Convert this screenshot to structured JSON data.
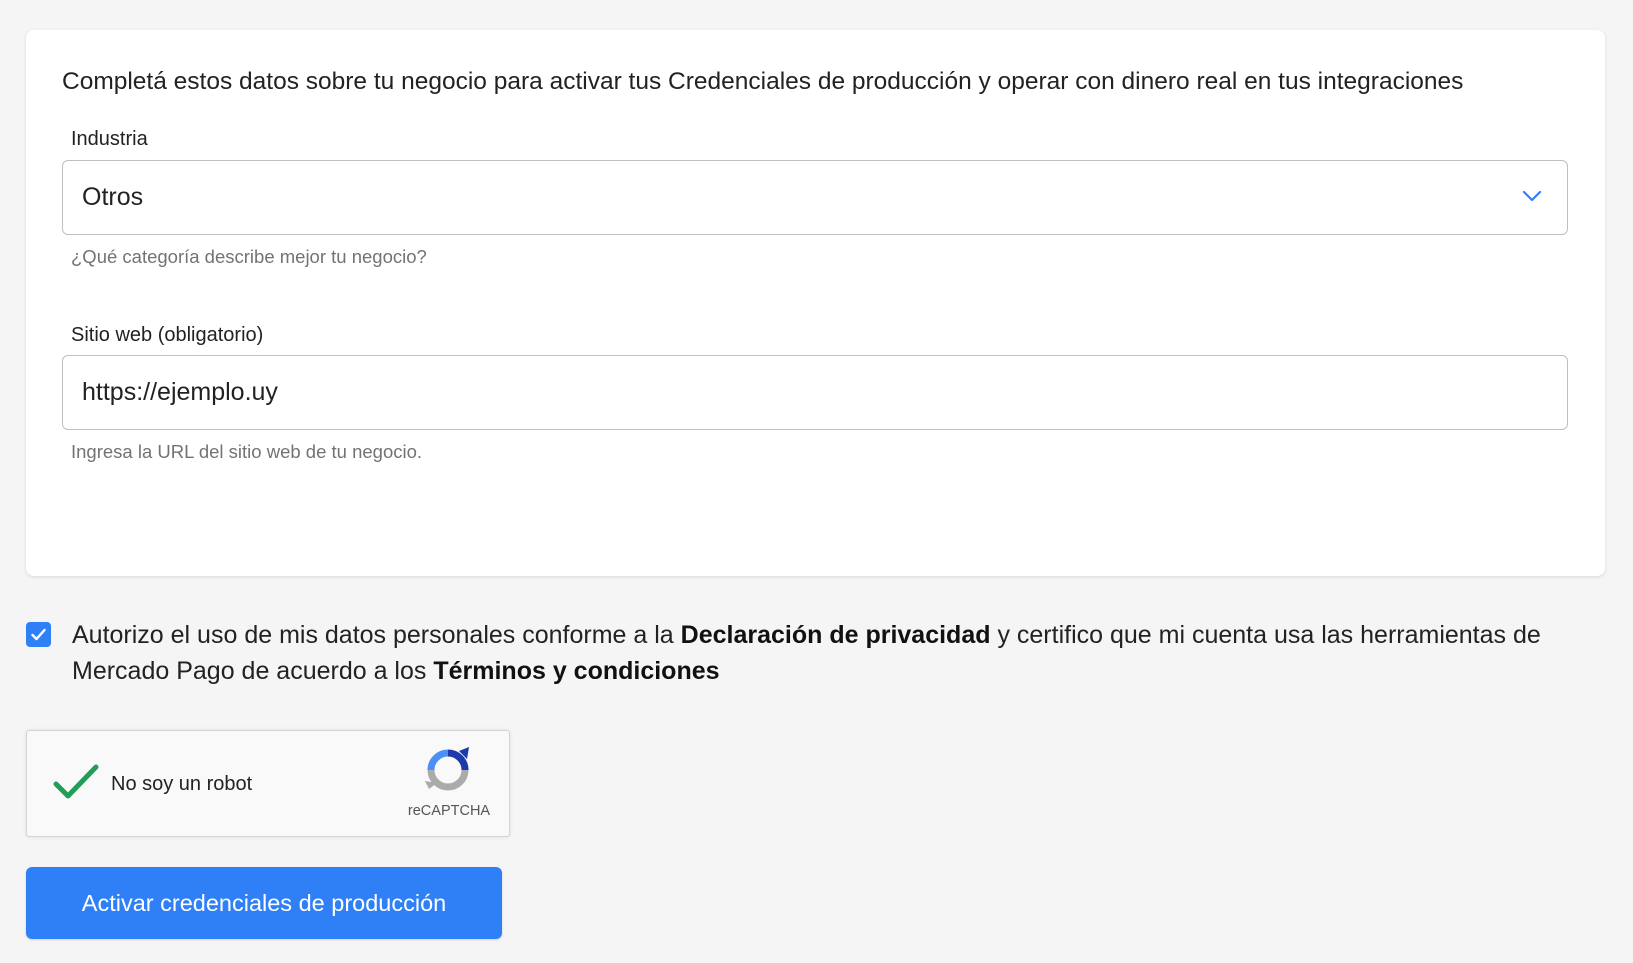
{
  "form": {
    "intro": "Completá estos datos sobre tu negocio para activar tus Credenciales de producción y operar con dinero real en tus integraciones",
    "industry": {
      "label": "Industria",
      "value": "Otros",
      "helper": "¿Qué categoría describe mejor tu negocio?"
    },
    "website": {
      "label": "Sitio web (obligatorio)",
      "value": "https://ejemplo.uy",
      "helper": "Ingresa la URL del sitio web de tu negocio."
    }
  },
  "consent": {
    "checked": true,
    "text_part1": "Autorizo el uso de mis datos personales conforme a la ",
    "privacy_link": "Declaración de privacidad",
    "text_part2": " y certifico que mi cuenta usa las herramientas de Mercado Pago de acuerdo a los ",
    "terms_link": "Términos y condiciones"
  },
  "recaptcha": {
    "label": "No soy un robot",
    "brand": "reCAPTCHA",
    "checked": true
  },
  "submit": {
    "label": "Activar credenciales de producción"
  },
  "colors": {
    "accent": "#2f80f7",
    "check_green": "#1e9e56",
    "background": "#f5f5f5"
  }
}
